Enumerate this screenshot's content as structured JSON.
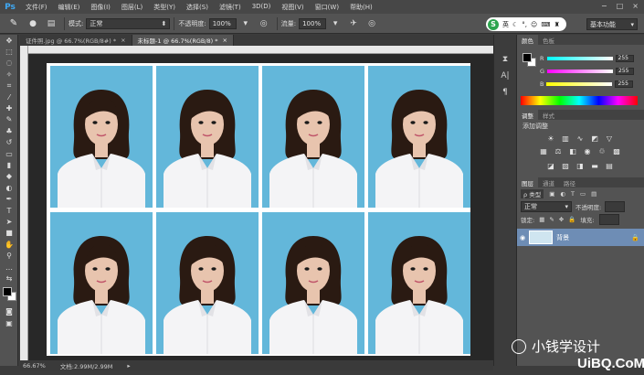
{
  "app": {
    "logo": "Ps"
  },
  "menus": [
    "文件(F)",
    "编辑(E)",
    "图像(I)",
    "图层(L)",
    "类型(Y)",
    "选择(S)",
    "滤镜(T)",
    "3D(D)",
    "视图(V)",
    "窗口(W)",
    "帮助(H)"
  ],
  "window_controls": [
    "−",
    "□",
    "×"
  ],
  "options": {
    "mode_label": "模式:",
    "mode_value": "正常",
    "opacity_label": "不透明度:",
    "opacity_value": "100%",
    "flow_label": "流量:",
    "flow_value": "100%",
    "workspace": "基本功能"
  },
  "brand_badge": {
    "letter": "S",
    "text": "英"
  },
  "tabs": [
    {
      "label": "证件照.jpg @ 66.7%(RGB/8#) *",
      "close": "×"
    },
    {
      "label": "未标题-1 @ 66.7%(RGB/8) *",
      "close": "×"
    }
  ],
  "status": {
    "zoom": "66.67%",
    "doc": "文档:2.99M/2.99M"
  },
  "panels": {
    "color_tabs": [
      "颜色",
      "色板"
    ],
    "channels": [
      {
        "name": "R",
        "value": "255",
        "gradient": "linear-gradient(90deg,#00ffff,#ffffff)"
      },
      {
        "name": "G",
        "value": "255",
        "gradient": "linear-gradient(90deg,#ff00ff,#ffffff)"
      },
      {
        "name": "B",
        "value": "255",
        "gradient": "linear-gradient(90deg,#ffff00,#ffffff)"
      }
    ],
    "adjust_tabs": [
      "调整",
      "样式"
    ],
    "adjust_title": "添加调整",
    "layers_tabs": [
      "图层",
      "通道",
      "路径"
    ],
    "kind_label": "ρ 类型",
    "blend_mode": "正常",
    "opacity_label": "不透明度:",
    "lock_label": "锁定:",
    "fill_label": "填充:",
    "layer_name": "背景"
  },
  "watermark": {
    "text": "小钱学设计",
    "site": "UiBQ.CoM"
  },
  "colors": {
    "sky": "#63b7da",
    "hair": "#2a1a12",
    "shirt": "#f4f4f6",
    "skin": "#e8c4ae",
    "accent": "#3fa9f5"
  }
}
